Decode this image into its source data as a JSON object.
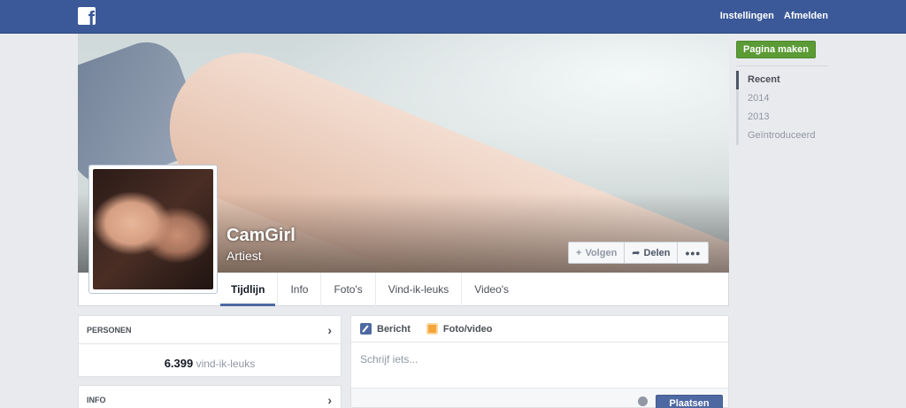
{
  "topbar": {
    "logo_icon": "facebook-logo-icon",
    "links": [
      "Instellingen",
      "Afmelden"
    ]
  },
  "profile": {
    "name": "CamGirl",
    "category": "Artiest"
  },
  "cover_actions": {
    "follow": "Volgen",
    "share": "Delen",
    "more_icon": "more-dots-icon"
  },
  "nav": {
    "tabs": [
      "Tijdlijn",
      "Info",
      "Foto's",
      "Vind-ik-leuks",
      "Video's"
    ],
    "active": "Tijdlijn"
  },
  "right": {
    "create_page": "Pagina maken",
    "timeline_years": [
      "Recent",
      "2014",
      "2013",
      "Geïntroduceerd"
    ]
  },
  "people_box": {
    "title": "PERSONEN",
    "likes_count": "6.399",
    "likes_label": "vind-ik-leuks"
  },
  "info_box": {
    "title": "INFO"
  },
  "composer": {
    "tab_post": "Bericht",
    "tab_photo": "Foto/video",
    "placeholder": "Schrijf iets...",
    "post_button": "Plaatsen"
  },
  "colors": {
    "topbar": "#3b5998",
    "accent": "#4e69a2",
    "create_page_green": "#5b9a35"
  }
}
